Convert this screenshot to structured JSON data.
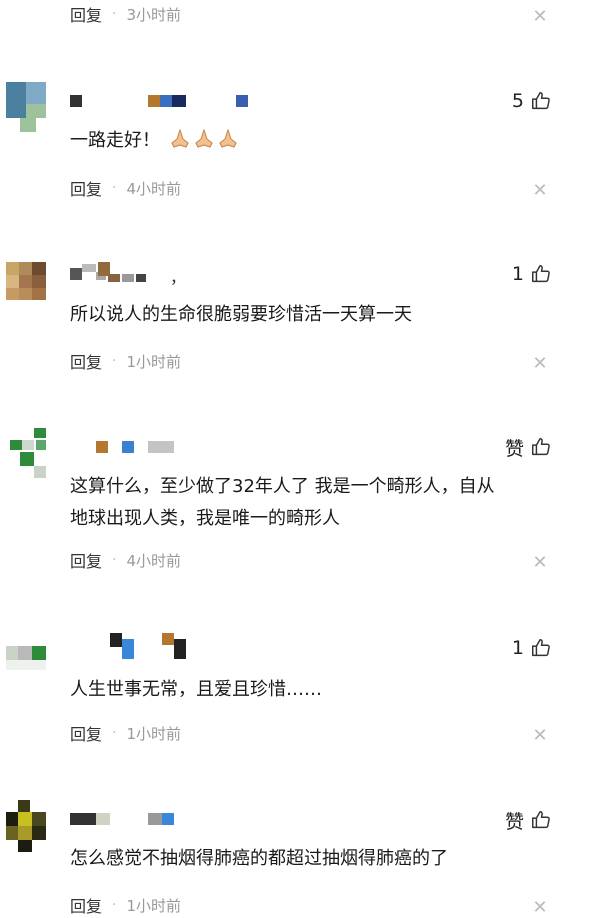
{
  "reply_label": "回复",
  "dot": "·",
  "close_glyph": "✕",
  "top_meta": {
    "time": "3小时前"
  },
  "comments": [
    {
      "id": 1,
      "content": "一路走好！",
      "emoji": "🙏🙏🙏",
      "likes": "5",
      "time": "4小时前"
    },
    {
      "id": 2,
      "name_suffix": "，",
      "content": "所以说人的生命很脆弱要珍惜活一天算一天",
      "likes": "1",
      "time": "1小时前"
    },
    {
      "id": 3,
      "content_line1": "这算什么，至少做了32年人了 我是一个畸形人，自从",
      "content_line2": "地球出现人类，我是唯一的畸形人",
      "likes": "赞",
      "time": "4小时前"
    },
    {
      "id": 4,
      "content": "人生世事无常，且爱且珍惜……",
      "likes": "1",
      "time": "1小时前"
    },
    {
      "id": 5,
      "content": "怎么感觉不抽烟得肺癌的都超过抽烟得肺癌的了",
      "likes": "赞",
      "time": "1小时前"
    }
  ],
  "colors": {
    "text": "#1a1a1a",
    "muted": "#999999",
    "close": "#bbbbbb"
  }
}
